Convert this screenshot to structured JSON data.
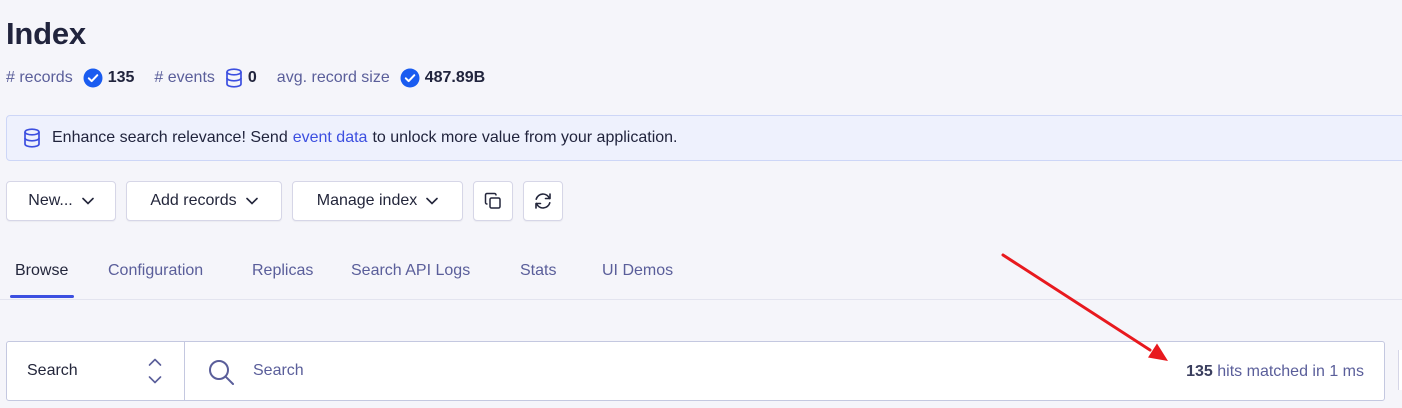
{
  "header": {
    "title": "Index",
    "stats": {
      "records_label": "# records",
      "records_value": "135",
      "events_label": "# events",
      "events_value": "0",
      "avg_size_label": "avg. record size",
      "avg_size_value": "487.89B"
    }
  },
  "banner": {
    "text_before": "Enhance search relevance! Send",
    "link": "event data",
    "text_after": "to unlock more value from your application."
  },
  "toolbar": {
    "new_label": "New...",
    "add_records_label": "Add records",
    "manage_index_label": "Manage index",
    "copy_icon": "copy-icon",
    "refresh_icon": "refresh-icon"
  },
  "tabs": [
    {
      "label": "Browse",
      "active": true
    },
    {
      "label": "Configuration",
      "active": false
    },
    {
      "label": "Replicas",
      "active": false
    },
    {
      "label": "Search API Logs",
      "active": false
    },
    {
      "label": "Stats",
      "active": false
    },
    {
      "label": "UI Demos",
      "active": false
    }
  ],
  "search": {
    "type_selected": "Search",
    "placeholder": "Search",
    "hits_count": "135",
    "hits_text": "hits matched in 1 ms"
  },
  "colors": {
    "accent": "#3c4fe0",
    "check": "#1a5cf0",
    "annotation_arrow": "#e8191e"
  }
}
